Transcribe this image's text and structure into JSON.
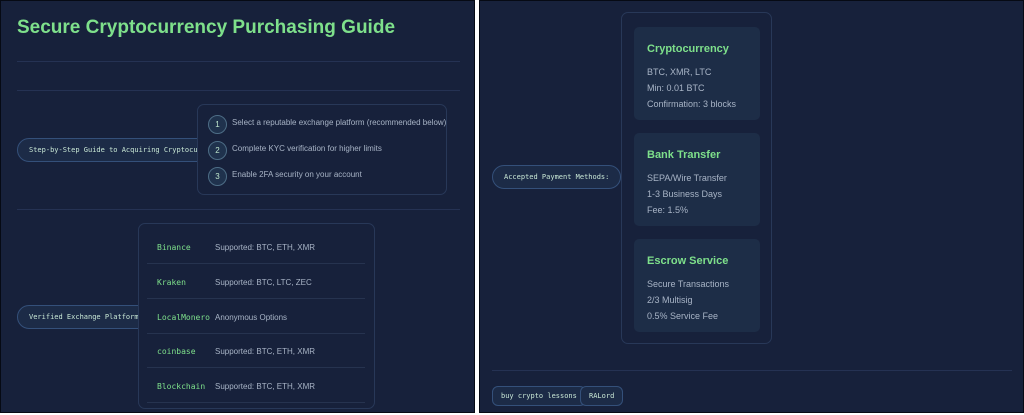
{
  "page": {
    "title": "Secure Cryptocurrency Purchasing Guide",
    "guide_label": "Step-by-Step Guide to Acquiring Cryptocurrency:",
    "steps": [
      {
        "number": "1",
        "text": "Select a reputable exchange platform (recommended below)"
      },
      {
        "number": "2",
        "text": "Complete KYC verification for higher limits"
      },
      {
        "number": "3",
        "text": "Enable 2FA security on your account"
      }
    ],
    "exchanges_label": "Verified Exchange Platforms:",
    "exchanges": [
      {
        "name": "Binance",
        "desc": "Supported: BTC, ETH, XMR"
      },
      {
        "name": "Kraken",
        "desc": "Supported: BTC, LTC, ZEC"
      },
      {
        "name": "LocalMonero",
        "desc": "Anonymous Options"
      },
      {
        "name": "coinbase",
        "desc": "Supported: BTC, ETH, XMR"
      },
      {
        "name": "Blockchain",
        "desc": "Supported: BTC, ETH, XMR"
      }
    ],
    "payment_label": "Accepted Payment Methods:",
    "payment_methods": [
      {
        "title": "Cryptocurrency",
        "lines": [
          "BTC, XMR, LTC",
          "Min: 0.01 BTC",
          "Confirmation: 3 blocks"
        ]
      },
      {
        "title": "Bank Transfer",
        "lines": [
          "SEPA/Wire Transfer",
          "1-3 Business Days",
          "Fee: 1.5%"
        ]
      },
      {
        "title": "Escrow Service",
        "lines": [
          "Secure Transactions",
          "2/3 Multisig",
          "0.5% Service Fee"
        ]
      }
    ],
    "footer_tags": [
      "buy crypto lessons",
      "RALord"
    ]
  },
  "colors": {
    "background": "#17213b",
    "accent": "#7ee08b",
    "card": "#1d2d47",
    "text_muted": "#a8b4c6"
  }
}
